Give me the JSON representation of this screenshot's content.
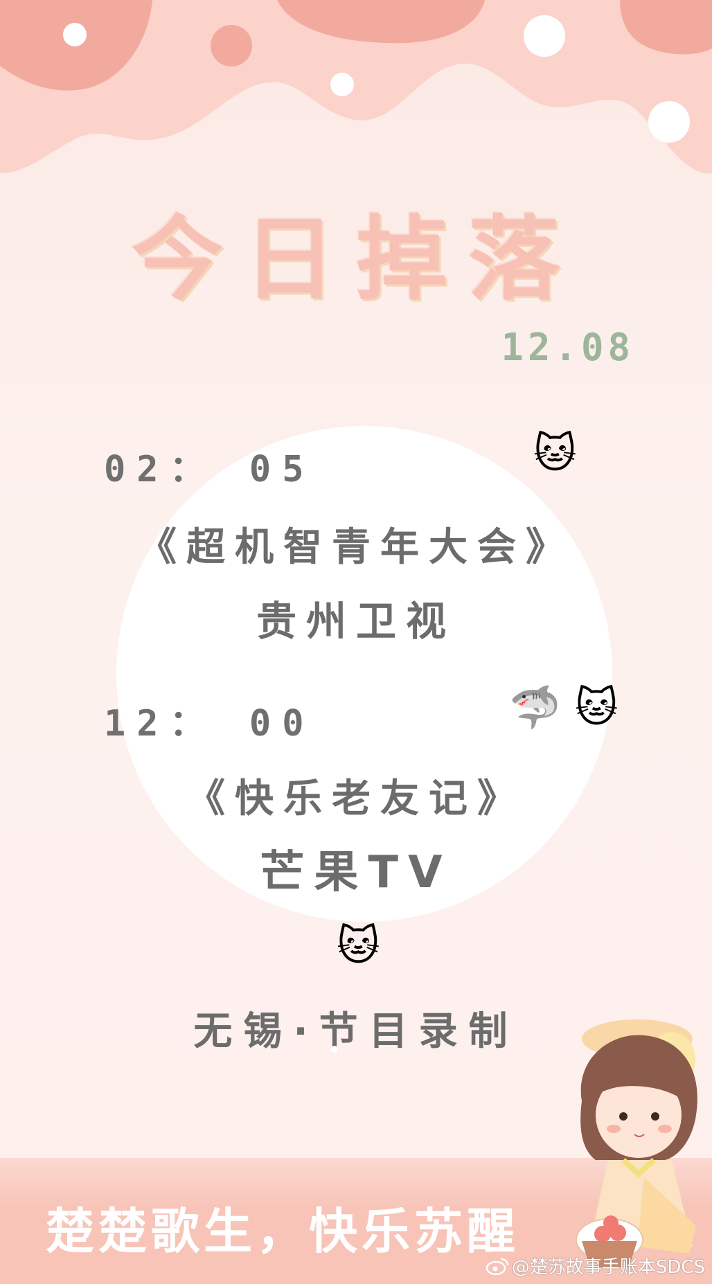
{
  "title": "今日掉落",
  "date": "12.08",
  "schedule": [
    {
      "time": "02： 05",
      "show": "《超机智青年大会》",
      "channel": "贵州卫视"
    },
    {
      "time": "12： 00",
      "show": "《快乐老友记》",
      "channel": "芒果TV"
    }
  ],
  "recording": "无锡·节目录制",
  "slogan": "楚楚歌生，快乐苏醒",
  "watermark": "@楚苏故事手账本SDCS",
  "colors": {
    "title_pink": "#f8c1b6",
    "date_green": "#9db59a",
    "text_gray": "#6c6c6c",
    "cloud_dark": "#f2aa9e",
    "cloud_light": "#fbd3ca",
    "band_pink": "#f8c4b8"
  },
  "icons": [
    "cat-face-icon",
    "shark-icon",
    "weibo-icon"
  ]
}
